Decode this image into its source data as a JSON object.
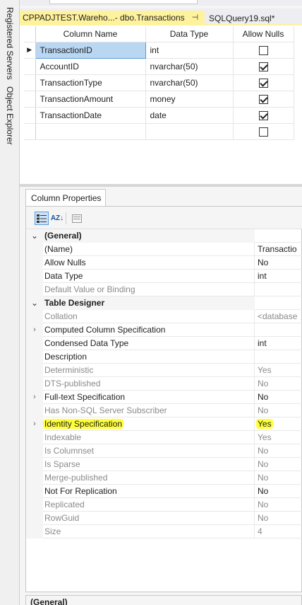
{
  "side_strip": {
    "items": [
      "Registered Servers",
      "Object Explorer"
    ]
  },
  "tabs": {
    "active": {
      "label": "CPPADJTEST.Wareho...- dbo.Transactions",
      "pin": "⊣",
      "close": "✕"
    },
    "inactive": {
      "label": "SQLQuery19.sql*"
    }
  },
  "grid": {
    "headers": [
      "Column Name",
      "Data Type",
      "Allow Nulls"
    ],
    "rows": [
      {
        "name": "TransactionID",
        "type": "int",
        "nulls": false
      },
      {
        "name": "AccountID",
        "type": "nvarchar(50)",
        "nulls": true
      },
      {
        "name": "TransactionType",
        "type": "nvarchar(50)",
        "nulls": true
      },
      {
        "name": "TransactionAmount",
        "type": "money",
        "nulls": true
      },
      {
        "name": "TransactionDate",
        "type": "date",
        "nulls": true
      },
      {
        "name": "",
        "type": "",
        "nulls": false
      }
    ]
  },
  "props": {
    "tab_label": "Column Properties",
    "toolbar": {
      "alpha_label": "AZ↓"
    },
    "rows": [
      {
        "name": "(General)",
        "value": ""
      },
      {
        "name": "(Name)",
        "value": "Transactio"
      },
      {
        "name": "Allow Nulls",
        "value": "No"
      },
      {
        "name": "Data Type",
        "value": "int"
      },
      {
        "name": "Default Value or Binding",
        "value": ""
      },
      {
        "name": "Table Designer",
        "value": ""
      },
      {
        "name": "Collation",
        "value": "<database"
      },
      {
        "name": "Computed Column Specification",
        "value": ""
      },
      {
        "name": "Condensed Data Type",
        "value": "int"
      },
      {
        "name": "Description",
        "value": ""
      },
      {
        "name": "Deterministic",
        "value": "Yes"
      },
      {
        "name": "DTS-published",
        "value": "No"
      },
      {
        "name": "Full-text Specification",
        "value": "No"
      },
      {
        "name": "Has Non-SQL Server Subscriber",
        "value": "No"
      },
      {
        "name": "Identity Specification",
        "value": "Yes"
      },
      {
        "name": "Indexable",
        "value": "Yes"
      },
      {
        "name": "Is Columnset",
        "value": "No"
      },
      {
        "name": "Is Sparse",
        "value": "No"
      },
      {
        "name": "Merge-published",
        "value": "No"
      },
      {
        "name": "Not For Replication",
        "value": "No"
      },
      {
        "name": "Replicated",
        "value": "No"
      },
      {
        "name": "RowGuid",
        "value": "No"
      },
      {
        "name": "Size",
        "value": "4"
      }
    ],
    "description_title": "(General)"
  },
  "colors": {
    "tab_active": "#fff29d",
    "highlight": "#ffff3a",
    "selection": "#b9d6f2"
  }
}
